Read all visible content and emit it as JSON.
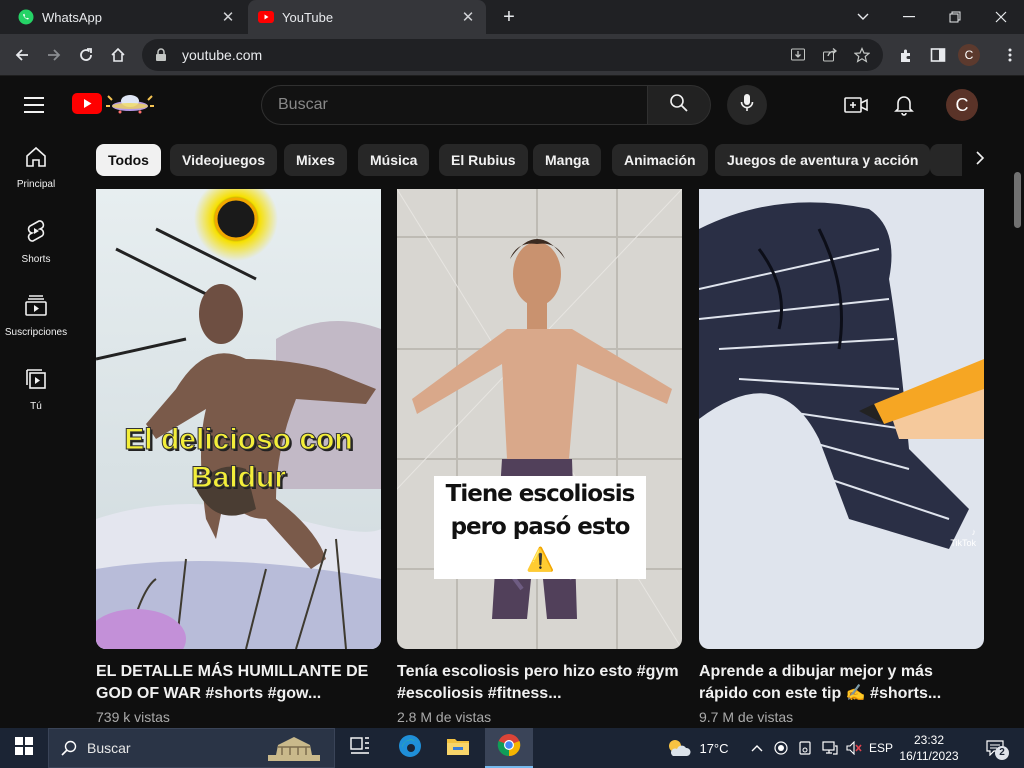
{
  "browser": {
    "tabs": [
      {
        "title": "WhatsApp",
        "icon": "whatsapp-icon",
        "active": false
      },
      {
        "title": "YouTube",
        "icon": "youtube-icon",
        "active": true
      }
    ],
    "url": "youtube.com",
    "profile_initial": "C"
  },
  "youtube": {
    "search_placeholder": "Buscar",
    "avatar_initial": "C",
    "rail": [
      {
        "label": "Principal",
        "icon": "home-icon"
      },
      {
        "label": "Shorts",
        "icon": "shorts-icon"
      },
      {
        "label": "Suscripciones",
        "icon": "subscriptions-icon"
      },
      {
        "label": "Tú",
        "icon": "you-icon"
      }
    ],
    "chips": [
      "Todos",
      "Videojuegos",
      "Mixes",
      "Música",
      "El Rubius",
      "Manga",
      "Animación",
      "Juegos de aventura y acción"
    ],
    "selected_chip": "Todos",
    "videos": [
      {
        "title": "EL DETALLE MÁS HUMILLANTE DE GOD OF WAR #shorts #gow...",
        "views": "739 k vistas",
        "overlay": "El delicioso con Baldur"
      },
      {
        "title": "Tenía escoliosis pero hizo esto #gym #escoliosis #fitness...",
        "views": "2.8 M de vistas",
        "overlay": "Tiene escoliosis pero pasó esto ⚠️"
      },
      {
        "title": "Aprende a dibujar mejor y más rápido con este tip ✍️ #shorts...",
        "views": "9.7 M de vistas",
        "overlay": "TikTok"
      }
    ]
  },
  "taskbar": {
    "search_placeholder": "Buscar",
    "weather": "17°C",
    "language": "ESP",
    "time": "23:32",
    "date": "16/11/2023",
    "notifications": "2"
  },
  "colors": {
    "youtube_red": "#ff0000",
    "background": "#0f0f0f",
    "chip": "#272727",
    "overlay_yellow": "#f3ee3a"
  }
}
